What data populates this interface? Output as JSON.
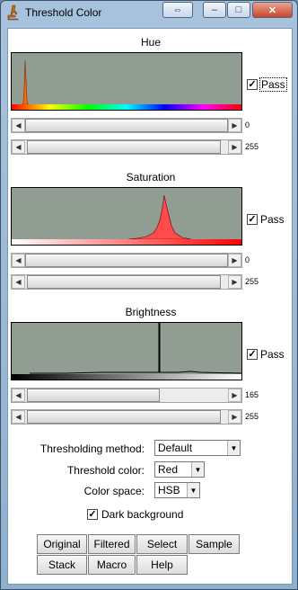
{
  "window": {
    "title": "Threshold Color",
    "controls": {
      "restore": "⇔",
      "minimize": "–",
      "maximize": "□",
      "close": "✕"
    }
  },
  "hue": {
    "title": "Hue",
    "pass_label": "Pass",
    "pass_checked": true,
    "min_value": "0",
    "max_value": "255",
    "min_fraction": 0,
    "max_fraction": 1
  },
  "saturation": {
    "title": "Saturation",
    "pass_label": "Pass",
    "pass_checked": true,
    "min_value": "0",
    "max_value": "255",
    "min_fraction": 0,
    "max_fraction": 1
  },
  "brightness": {
    "title": "Brightness",
    "pass_label": "Pass",
    "pass_checked": true,
    "min_value": "165",
    "max_value": "255",
    "min_fraction": 0.647,
    "max_fraction": 1
  },
  "options": {
    "method_label": "Thresholding method:",
    "method_value": "Default",
    "color_label": "Threshold color:",
    "color_value": "Red",
    "space_label": "Color space:",
    "space_value": "HSB",
    "dark_background_label": "Dark background",
    "dark_background_checked": true
  },
  "buttons": {
    "original": "Original",
    "filtered": "Filtered",
    "select": "Select",
    "sample": "Sample",
    "stack": "Stack",
    "macro": "Macro",
    "help": "Help"
  },
  "colors": {
    "histogram_background": "#919c93",
    "hue_histogram": "#ff6a00",
    "saturation_histogram": "#ff4b4b",
    "brightness_histogram": "#000000"
  }
}
